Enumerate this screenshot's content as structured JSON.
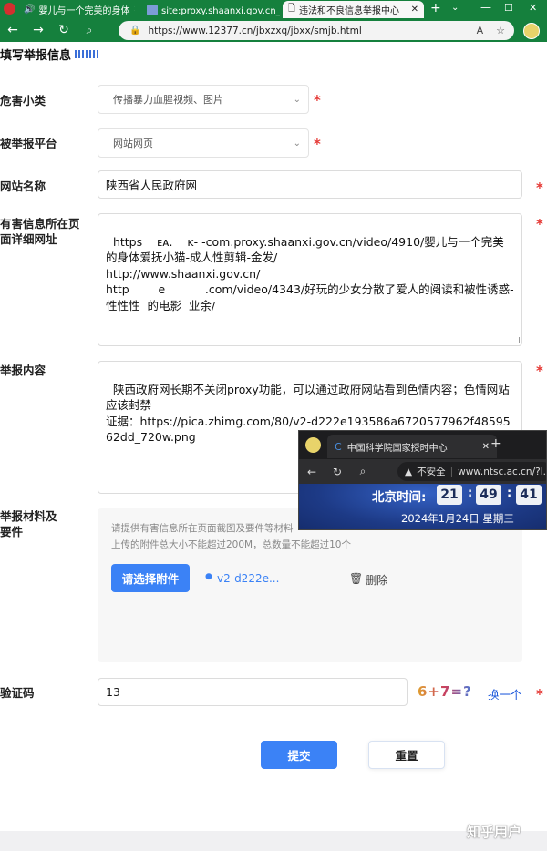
{
  "browser": {
    "tabs": [
      {
        "label": "婴儿与一个完美的身体"
      },
      {
        "label": "site:proxy.shaanxi.gov.cn_百"
      },
      {
        "label": "违法和不良信息举报中心"
      }
    ],
    "url": "https://www.12377.cn/jbxzxq/jbxx/smjb.html"
  },
  "form": {
    "section_title": "填写举报信息",
    "harm_type": {
      "label": "危害小类",
      "value": "传播暴力血腥视频、图片"
    },
    "platform": {
      "label": "被举报平台",
      "value": "网站网页"
    },
    "site_name": {
      "label": "网站名称",
      "value": "陕西省人民政府网"
    },
    "detail_url": {
      "label": "有害信息所在页面详细网址",
      "value": "https    ᴇᴀ.    ᴋ- -com.proxy.shaanxi.gov.cn/video/4910/婴儿与一个完美的身体爱抚小猫-成人性剪辑-金发/\nhttp://www.shaanxi.gov.cn/\nhttp        e           .com/video/4343/好玩的少女分散了爱人的阅读和被性诱惑-性性性  的电影  业余/"
    },
    "content": {
      "label": "举报内容",
      "value": "陕西政府网长期不关闭proxy功能，可以通过政府网站看到色情内容；色情网站应该封禁\n证据：https://pica.zhimg.com/80/v2-d222e193586a6720577962f4859562dd_720w.png"
    },
    "attachments": {
      "label": "举报材料及要件",
      "hint1": "请提供有害信息所在页面截图及要件等材料",
      "hint2": "上传的附件总大小不能超过200M，总数量不能超过10个",
      "button": "请选择附件",
      "file_name": "v2-d222e...",
      "delete_label": "删除"
    },
    "captcha": {
      "label": "验证码",
      "value": "13",
      "image_text": "6+7=?",
      "refresh": "换一个"
    },
    "required_mark": "*",
    "submit": "提交",
    "reset": "重置"
  },
  "overlay": {
    "tab_title": "中国科学院国家授时中心",
    "security": "不安全",
    "url": "www.ntsc.ac.cn/?l...",
    "time_label": "北京时间:",
    "hours": "21",
    "minutes": "49",
    "seconds": "41",
    "date": "2024年1月24日 星期三"
  },
  "watermark": "知乎用户",
  "colors": {
    "browser_green": "#15803d",
    "accent_blue": "#3b82f6",
    "required_red": "#e53935"
  }
}
